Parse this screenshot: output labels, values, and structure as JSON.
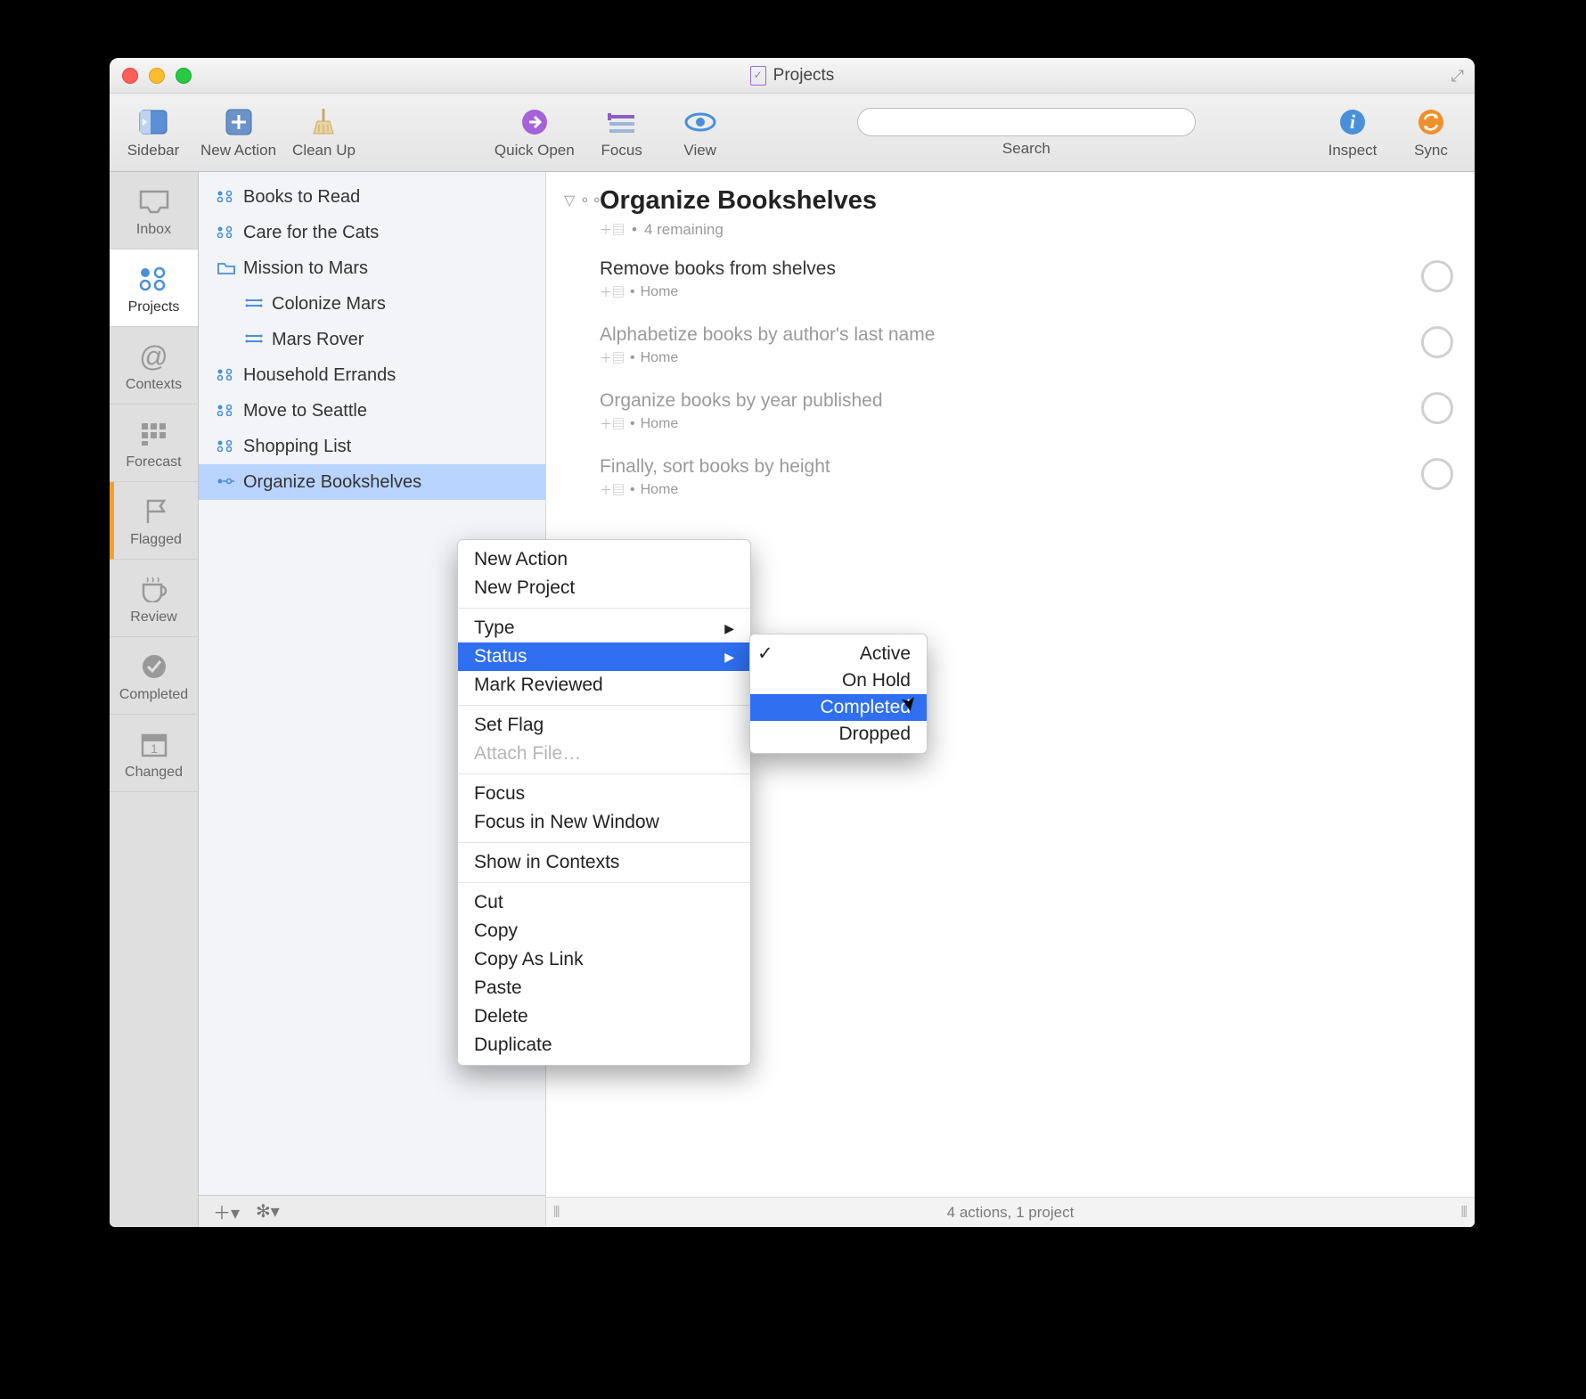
{
  "window": {
    "title": "Projects"
  },
  "toolbar": {
    "sidebar": "Sidebar",
    "new_action": "New Action",
    "clean_up": "Clean Up",
    "quick_open": "Quick Open",
    "focus": "Focus",
    "view": "View",
    "search_label": "Search",
    "search_placeholder": "",
    "inspect": "Inspect",
    "sync": "Sync"
  },
  "rail": {
    "inbox": "Inbox",
    "projects": "Projects",
    "contexts": "Contexts",
    "forecast": "Forecast",
    "flagged": "Flagged",
    "review": "Review",
    "completed": "Completed",
    "changed": "Changed"
  },
  "sidebar": {
    "items": [
      {
        "label": "Books to Read",
        "type": "project"
      },
      {
        "label": "Care for the Cats",
        "type": "project"
      },
      {
        "label": "Mission to Mars",
        "type": "folder"
      },
      {
        "label": "Colonize Mars",
        "type": "project",
        "indent": true
      },
      {
        "label": "Mars Rover",
        "type": "project",
        "indent": true
      },
      {
        "label": "Household Errands",
        "type": "project"
      },
      {
        "label": "Move to Seattle",
        "type": "project"
      },
      {
        "label": "Shopping List",
        "type": "project"
      },
      {
        "label": "Organize Bookshelves",
        "type": "project",
        "selected": true
      }
    ]
  },
  "content": {
    "project_title": "Organize Bookshelves",
    "project_sub": "4 remaining",
    "tasks": [
      {
        "title": "Remove books from shelves",
        "context": "Home",
        "dim": false
      },
      {
        "title": "Alphabetize books by author's last name",
        "context": "Home",
        "dim": true
      },
      {
        "title": "Organize books by year published",
        "context": "Home",
        "dim": true
      },
      {
        "title": "Finally, sort books by height",
        "context": "Home",
        "dim": true
      }
    ]
  },
  "status_bar": "4 actions, 1 project",
  "context_menu": {
    "items": [
      "New Action",
      "New Project",
      "-",
      "Type",
      "Status",
      "Mark Reviewed",
      "-",
      "Set Flag",
      "Attach File…",
      "-",
      "Focus",
      "Focus in New Window",
      "-",
      "Show in Contexts",
      "-",
      "Cut",
      "Copy",
      "Copy As Link",
      "Paste",
      "Delete",
      "Duplicate"
    ],
    "highlighted": "Status",
    "disabled": [
      "Attach File…"
    ],
    "submenu_for": "Status",
    "submenu": {
      "items": [
        "Active",
        "On Hold",
        "Completed",
        "Dropped"
      ],
      "checked": "Active",
      "highlighted": "Completed"
    }
  }
}
